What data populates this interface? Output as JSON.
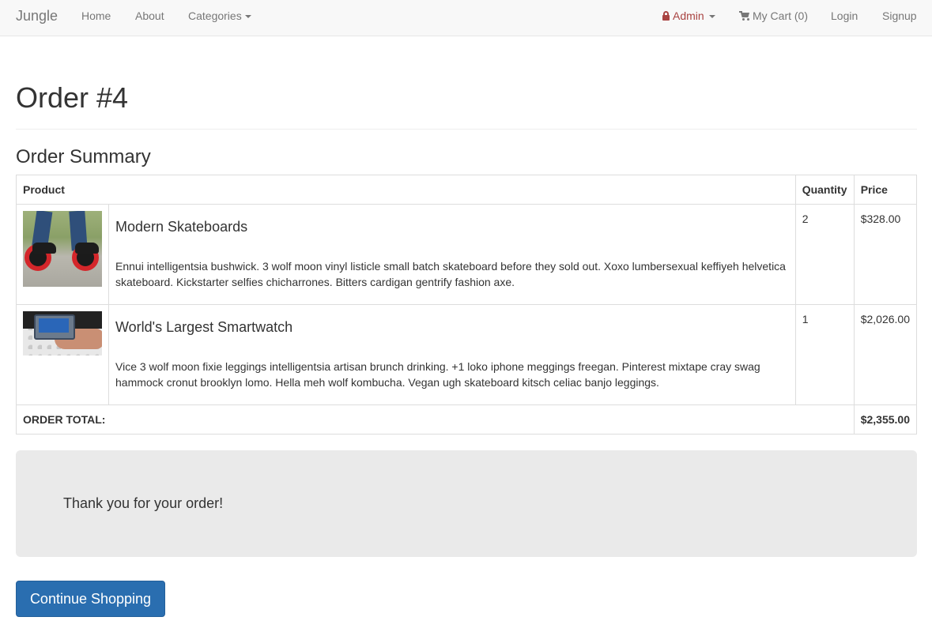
{
  "navbar": {
    "brand": "Jungle",
    "home": "Home",
    "about": "About",
    "categories": "Categories",
    "admin": "Admin",
    "cart": "My Cart (0)",
    "login": "Login",
    "signup": "Signup",
    "icons": {
      "admin": "lock-icon",
      "cart": "shopping-cart-icon"
    }
  },
  "page": {
    "title": "Order #4",
    "section_title": "Order Summary"
  },
  "table": {
    "headers": {
      "product": "Product",
      "quantity": "Quantity",
      "price": "Price"
    },
    "items": [
      {
        "name": "Modern Skateboards",
        "description": "Ennui intelligentsia bushwick. 3 wolf moon vinyl listicle small batch skateboard before they sold out. Xoxo lumbersexual keffiyeh helvetica skateboard. Kickstarter selfies chicharrones. Bitters cardigan gentrify fashion axe.",
        "quantity": "2",
        "price": "$328.00"
      },
      {
        "name": "World's Largest Smartwatch",
        "description": "Vice 3 wolf moon fixie leggings intelligentsia artisan brunch drinking. +1 loko iphone meggings freegan. Pinterest mixtape cray swag hammock cronut brooklyn lomo. Hella meh wolf kombucha. Vegan ugh skateboard kitsch celiac banjo leggings.",
        "quantity": "1",
        "price": "$2,026.00"
      }
    ],
    "total_label": "ORDER TOTAL:",
    "total_value": "$2,355.00"
  },
  "thanks": {
    "message": "Thank you for your order!"
  },
  "actions": {
    "continue_label": "Continue Shopping"
  },
  "colors": {
    "navbar_bg": "#f8f8f8",
    "admin": "#a94442",
    "primary_button": "#2a6eb0",
    "thanks_bg": "#eaeaea"
  }
}
